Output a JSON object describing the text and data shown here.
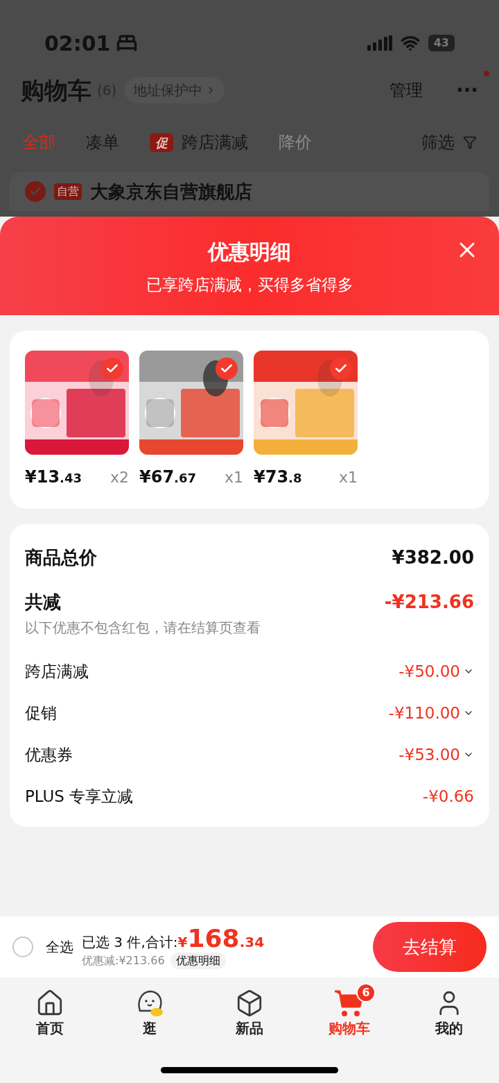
{
  "status_bar": {
    "time": "02:01",
    "battery": "43"
  },
  "header": {
    "title": "购物车",
    "count": "(6)",
    "address_badge": "地址保护中",
    "manage": "管理",
    "more": "···"
  },
  "filter_tabs": [
    {
      "label": "全部",
      "selected": true,
      "kind": "plain"
    },
    {
      "label": "凑单",
      "selected": false,
      "kind": "plain"
    },
    {
      "label": "跨店满减",
      "selected": false,
      "kind": "promo",
      "badge": "促"
    },
    {
      "label": "降价",
      "selected": false,
      "kind": "disabled"
    },
    {
      "label": "筛选",
      "selected": false,
      "kind": "filter"
    }
  ],
  "store": {
    "tag": "自营",
    "name": "大象京东自营旗舰店"
  },
  "sheet": {
    "title": "优惠明细",
    "subtitle": "已享跨店满减，买得多省得多",
    "products": [
      {
        "price_int": "¥13",
        "price_dec": ".43",
        "qty": "x2",
        "selected": true
      },
      {
        "price_int": "¥67",
        "price_dec": ".67",
        "qty": "x1",
        "selected": true
      },
      {
        "price_int": "¥73",
        "price_dec": ".8",
        "qty": "x1",
        "selected": true
      }
    ],
    "summary": [
      {
        "kind": "total",
        "label": "商品总价",
        "value": "¥382.00"
      },
      {
        "kind": "reduction",
        "label": "共减",
        "value": "-¥213.66",
        "note": "以下优惠不包含红包，请在结算页查看"
      },
      {
        "kind": "detail",
        "label": "跨店满减",
        "value": "-¥50.00",
        "expandable": true
      },
      {
        "kind": "detail",
        "label": "促销",
        "value": "-¥110.00",
        "expandable": true
      },
      {
        "kind": "detail",
        "label": "优惠券",
        "value": "-¥53.00",
        "expandable": true
      },
      {
        "kind": "detail",
        "label": "PLUS 专享立减",
        "value": "-¥0.66",
        "expandable": false
      }
    ]
  },
  "checkout": {
    "select_all": "全选",
    "checked": false,
    "selected_text": "已选 3 件,合计:",
    "currency": "¥",
    "total_int": "168",
    "total_dec": ".34",
    "discount": "优惠减:¥213.66",
    "detail_button": "优惠明细",
    "button": "去结算"
  },
  "tab_bar": [
    {
      "label": "首页",
      "kind": "home",
      "selected": false
    },
    {
      "label": "逛",
      "kind": "browse",
      "selected": false
    },
    {
      "label": "新品",
      "kind": "new",
      "selected": false
    },
    {
      "label": "购物车",
      "kind": "cart",
      "selected": true,
      "badge": "6"
    },
    {
      "label": "我的",
      "kind": "me",
      "selected": false
    }
  ]
}
